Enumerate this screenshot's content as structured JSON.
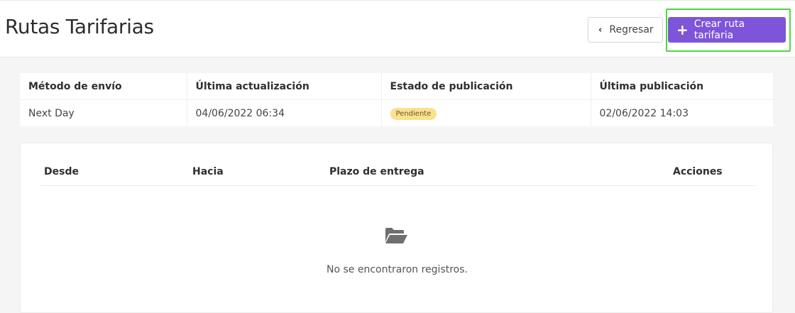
{
  "header": {
    "title": "Rutas Tarifarias",
    "back_label": "Regresar",
    "create_label": "Crear ruta tarifaria"
  },
  "info": {
    "columns": [
      "Método de envío",
      "Última actualización",
      "Estado de publicación",
      "Última publicación"
    ],
    "row": {
      "method": "Next Day",
      "updated": "04/06/2022 06:34",
      "status": "Pendiente",
      "published": "02/06/2022 14:03"
    }
  },
  "routes": {
    "columns": [
      "Desde",
      "Hacia",
      "Plazo de entrega",
      "Acciones"
    ],
    "empty_message": "No se encontraron registros."
  },
  "colors": {
    "primary": "#7e55d8",
    "badge_bg": "#fbe08e",
    "highlight": "#4cd93a"
  },
  "icons": [
    "chevron-left-icon",
    "plus-icon",
    "folder-open-icon"
  ]
}
